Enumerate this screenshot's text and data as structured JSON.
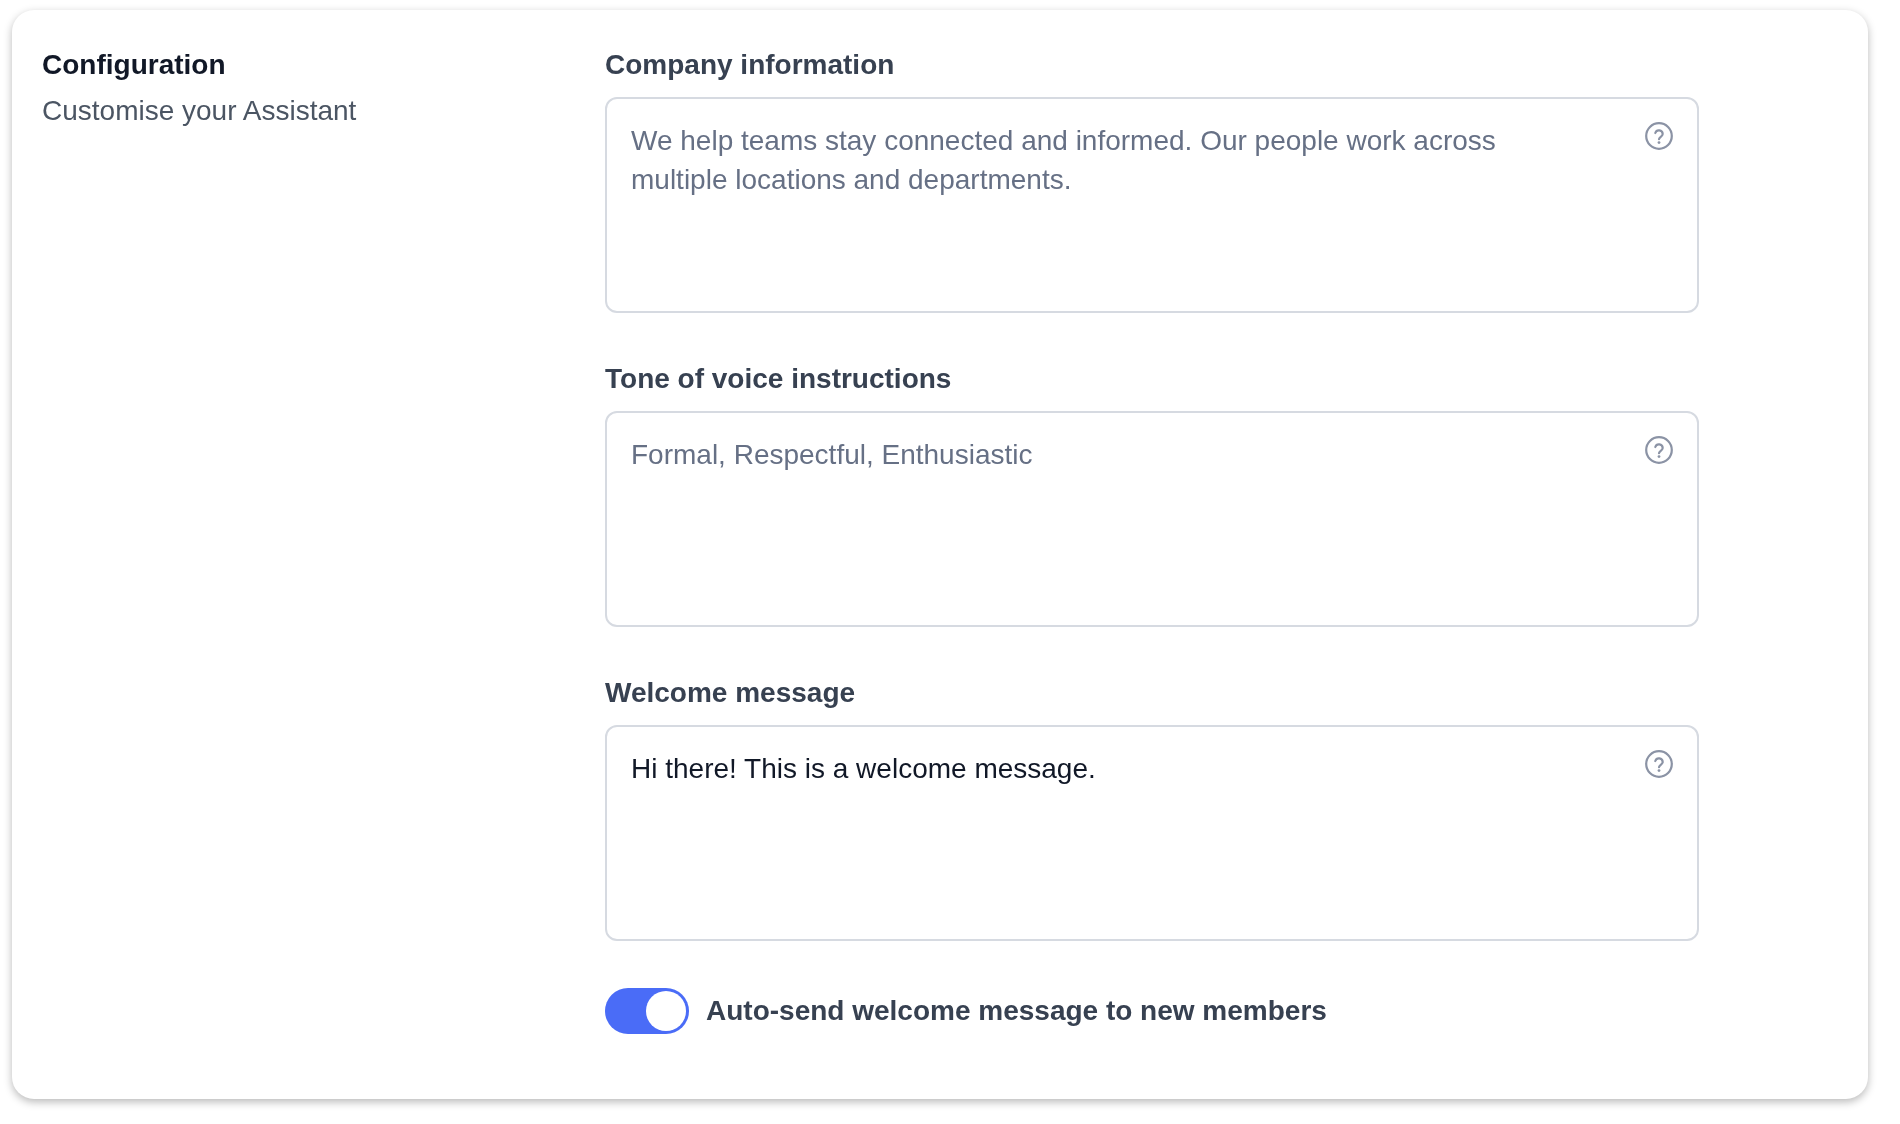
{
  "sidebar": {
    "title": "Configuration",
    "subtitle": "Customise your Assistant"
  },
  "fields": [
    {
      "label": "Company information",
      "placeholder": "We help teams stay connected and informed. Our people work across multiple locations and departments."
    },
    {
      "label": "Tone of voice instructions",
      "placeholder": "Formal, Respectful, Enthusiastic"
    },
    {
      "label": "Welcome message",
      "value": "Hi there! This is a welcome message."
    }
  ],
  "toggle": {
    "label": "Auto-send welcome message to new members",
    "on": true
  }
}
